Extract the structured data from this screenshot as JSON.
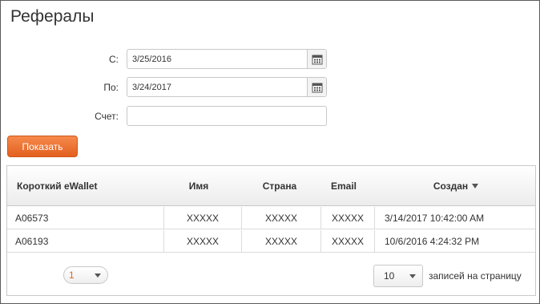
{
  "page": {
    "title": "Рефералы"
  },
  "form": {
    "from_label": "С:",
    "from_value": "3/25/2016",
    "to_label": "По:",
    "to_value": "3/24/2017",
    "account_label": "Счет:",
    "account_value": "",
    "show_button": "Показать"
  },
  "table": {
    "columns": [
      "Короткий eWallet",
      "Имя",
      "Страна",
      "Email",
      "Создан"
    ],
    "sort_column": "Создан",
    "rows": [
      [
        "A06573",
        "XXXXX",
        "XXXXX",
        "XXXXX",
        "3/14/2017 10:42:00 AM"
      ],
      [
        "A06193",
        "XXXXX",
        "XXXXX",
        "XXXXX",
        "10/6/2016 4:24:32 PM"
      ]
    ]
  },
  "pager": {
    "current_page": "1",
    "page_size": "10",
    "page_size_label": "записей на страницу"
  },
  "colors": {
    "accent": "#e8682a",
    "border": "#c9c9c9"
  }
}
